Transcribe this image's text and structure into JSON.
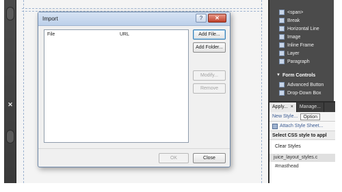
{
  "dialog": {
    "title": "Import",
    "help_glyph": "?",
    "close_glyph": "✕",
    "columns": [
      "File",
      "URL"
    ],
    "buttons": {
      "add_file": "Add File...",
      "add_folder": "Add Folder...",
      "modify": "Modify...",
      "remove": "Remove",
      "ok": "OK",
      "close": "Close"
    }
  },
  "toolbox": {
    "items": [
      "<span>",
      "Break",
      "Horizontal Line",
      "Image",
      "Inline Frame",
      "Layer",
      "Paragraph"
    ],
    "section": "Form Controls",
    "form_items": [
      "Advanced Button",
      "Drop-Down Box"
    ]
  },
  "styles_panel": {
    "tabs": [
      "Apply...",
      "Manage..."
    ],
    "tab_close_glyph": "×",
    "new_style": "New Style...",
    "options_button": "Option",
    "attach_style_sheet": "Attach Style Sheet...",
    "select_label": "Select CSS style to appl",
    "clear_styles": "Clear Styles",
    "stylesheet": "juice_layout_styles.c",
    "masthead": "#masthead"
  },
  "left_rail": {
    "close_glyph": "✕"
  },
  "icons": {
    "help": "help-icon",
    "close": "close-icon",
    "tool": "tool-icon"
  },
  "colors": {
    "panel": "#4b4b4b",
    "titlebar": "#bcd0ea",
    "close_button": "#c0412c",
    "link": "#3a5a92"
  }
}
